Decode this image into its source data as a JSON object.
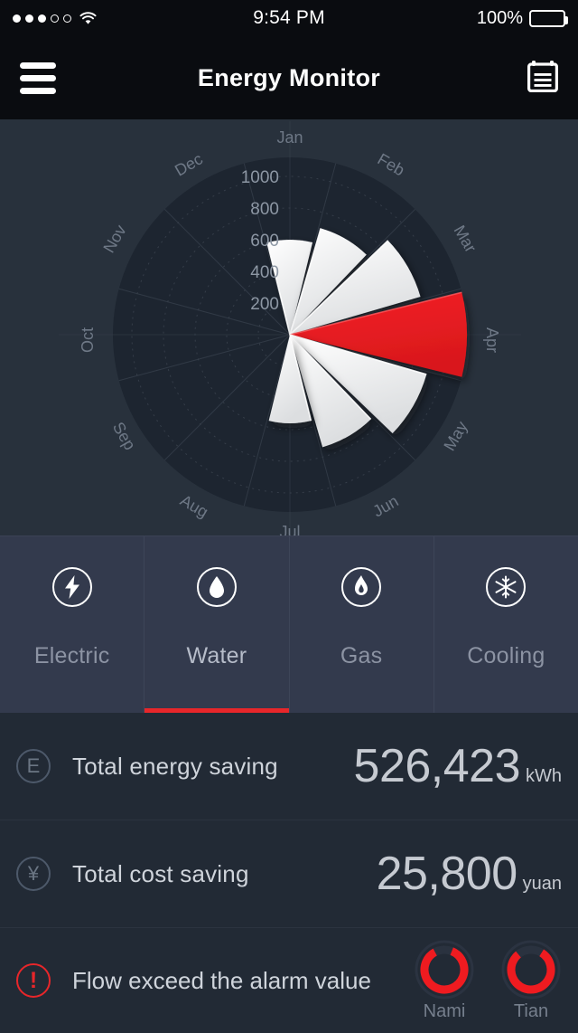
{
  "status_bar": {
    "signal_label": "signal-strength-3-of-5",
    "wifi_label": "wifi-icon",
    "time": "9:54 PM",
    "battery_percent": "100%"
  },
  "nav": {
    "menu_icon": "hamburger-menu-icon",
    "title": "Energy Monitor",
    "right_icon": "clipboard-calendar-icon"
  },
  "colors": {
    "accent_red": "#e8262a",
    "panel_bg": "#28313c",
    "chart_disc": "#1d2530",
    "tabbar_bg": "#333a4d",
    "row_bg": "#222a35",
    "navbar_bg": "#0a0c10",
    "sector_white": "#eceded",
    "grid": "#39424e",
    "label_gray": "#6e7886"
  },
  "chart_data": {
    "type": "bar",
    "polar": true,
    "title": "",
    "xlabel": "",
    "ylabel": "",
    "grid": true,
    "legend": "none",
    "categories": [
      "Jan",
      "Feb",
      "Mar",
      "Apr",
      "May",
      "Jun",
      "Jul",
      "Aug",
      "Sep",
      "Oct",
      "Nov",
      "Dec"
    ],
    "values": [
      600,
      700,
      860,
      1120,
      900,
      740,
      560,
      0,
      0,
      0,
      0,
      0
    ],
    "highlight_category": "Apr",
    "highlight_color": "#e8262a",
    "bar_color": "#eceded",
    "radial_ticks": [
      200,
      400,
      600,
      800,
      1000
    ],
    "rlim": [
      0,
      1120
    ],
    "angular_start_deg": 0,
    "angular_direction": "clockwise"
  },
  "tabs": [
    {
      "label": "Electric",
      "icon": "lightning-bolt-icon",
      "active": false
    },
    {
      "label": "Water",
      "icon": "water-drop-icon",
      "active": true
    },
    {
      "label": "Gas",
      "icon": "flame-icon",
      "active": false
    },
    {
      "label": "Cooling",
      "icon": "snowflake-icon",
      "active": false
    }
  ],
  "stats": [
    {
      "icon": "energy-e-icon",
      "icon_glyph": "E",
      "label": "Total energy saving",
      "value": "526,423",
      "unit": "kWh"
    },
    {
      "icon": "yuan-currency-icon",
      "icon_glyph": "¥",
      "label": "Total cost saving",
      "value": "25,800",
      "unit": "yuan"
    }
  ],
  "alarm": {
    "icon": "alert-exclamation-icon",
    "icon_glyph": "!",
    "label": "Flow exceed the alarm value",
    "gauges": [
      {
        "label": "Nami",
        "percent": 86
      },
      {
        "label": "Tian",
        "percent": 80
      }
    ]
  }
}
